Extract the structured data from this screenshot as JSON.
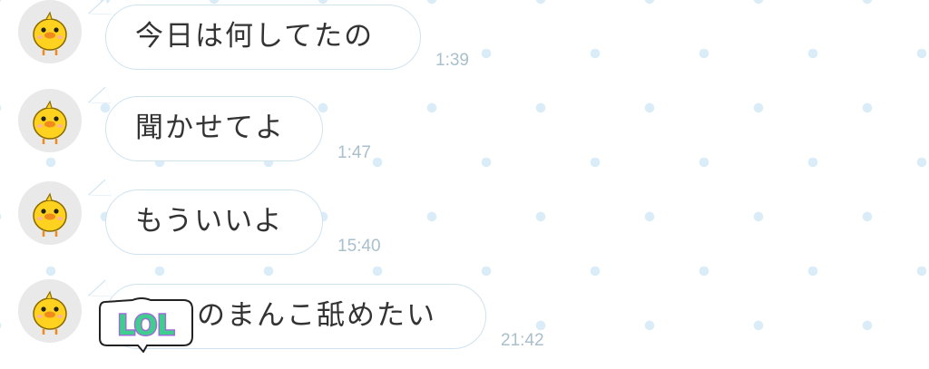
{
  "messages": [
    {
      "text": "今日は何してたの",
      "time": "1:39"
    },
    {
      "text": "聞かせてよ",
      "time": "1:47"
    },
    {
      "text": "もういいよ",
      "time": "15:40"
    },
    {
      "text": "のまんこ舐めたい",
      "time": "21:42",
      "sticker": "LOL"
    }
  ],
  "avatar_icon": "chick-icon",
  "colors": {
    "bubble_border": "#cfe3ef",
    "time": "#a9bfcc",
    "sticker_green": "#3ecf8e",
    "sticker_purple": "#9b6fd6"
  }
}
